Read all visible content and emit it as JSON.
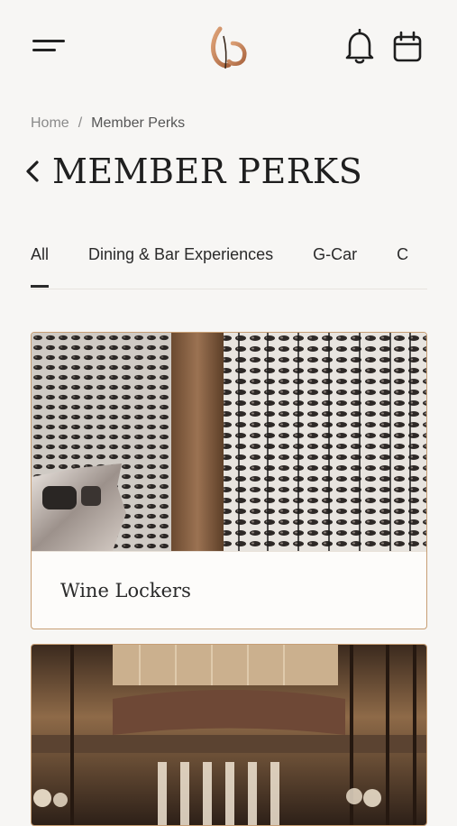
{
  "header": {
    "menu_icon": "hamburger-menu-icon",
    "logo_icon": "brand-g-logo-icon",
    "notification_icon": "bell-icon",
    "calendar_icon": "calendar-icon",
    "accent_color": "#c98a5e"
  },
  "breadcrumb": {
    "home": "Home",
    "separator": "/",
    "current": "Member Perks"
  },
  "page": {
    "title": "MEMBER PERKS",
    "back_icon": "chevron-left-icon"
  },
  "tabs": [
    {
      "label": "All",
      "active": true
    },
    {
      "label": "Dining & Bar Experiences",
      "active": false
    },
    {
      "label": "G-Car",
      "active": false
    },
    {
      "label": "C",
      "active": false
    }
  ],
  "cards": [
    {
      "title": "Wine Lockers"
    },
    {
      "title": ""
    }
  ],
  "colors": {
    "background": "#f7f6f4",
    "card_border": "#c79e74"
  }
}
